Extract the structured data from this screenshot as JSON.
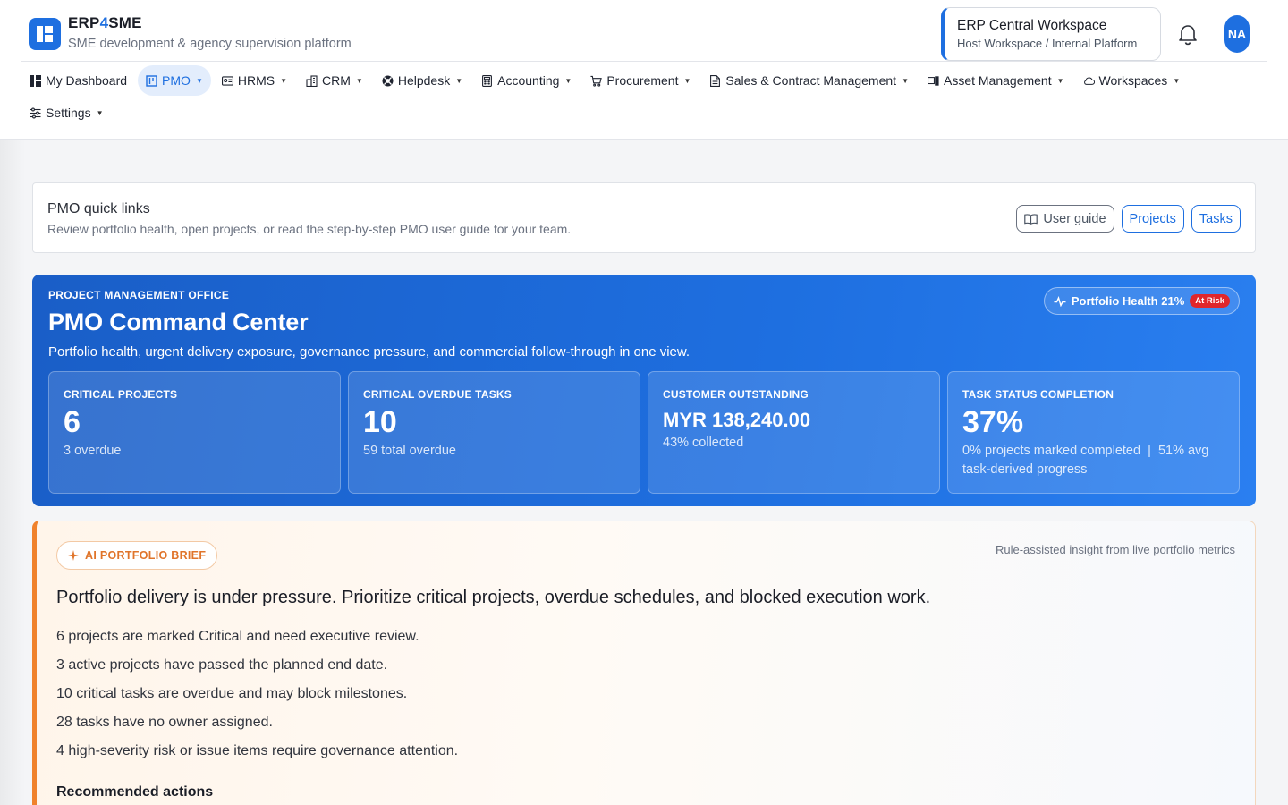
{
  "brand": {
    "name_prefix": "ERP",
    "name_accent": "4",
    "name_suffix": "SME",
    "subtitle": "SME development & agency supervision platform"
  },
  "workspace": {
    "title": "ERP Central Workspace",
    "subtitle": "Host Workspace / Internal Platform"
  },
  "user": {
    "initials": "NA"
  },
  "nav": {
    "items": [
      {
        "label": "My Dashboard",
        "icon": "dashboard-icon",
        "has_caret": false,
        "active": false
      },
      {
        "label": "PMO",
        "icon": "pmo-icon",
        "has_caret": true,
        "active": true
      },
      {
        "label": "HRMS",
        "icon": "id-card-icon",
        "has_caret": true,
        "active": false
      },
      {
        "label": "CRM",
        "icon": "building-icon",
        "has_caret": true,
        "active": false
      },
      {
        "label": "Helpdesk",
        "icon": "lifebuoy-icon",
        "has_caret": true,
        "active": false
      },
      {
        "label": "Accounting",
        "icon": "calculator-icon",
        "has_caret": true,
        "active": false
      },
      {
        "label": "Procurement",
        "icon": "cart-icon",
        "has_caret": true,
        "active": false
      },
      {
        "label": "Sales & Contract Management",
        "icon": "document-icon",
        "has_caret": true,
        "active": false
      },
      {
        "label": "Asset Management",
        "icon": "devices-icon",
        "has_caret": true,
        "active": false
      },
      {
        "label": "Workspaces",
        "icon": "cloud-icon",
        "has_caret": true,
        "active": false
      },
      {
        "label": "Settings",
        "icon": "sliders-icon",
        "has_caret": true,
        "active": false
      }
    ]
  },
  "quick_links": {
    "title": "PMO quick links",
    "description": "Review portfolio health, open projects, or read the step-by-step PMO user guide for your team.",
    "user_guide_label": "User guide",
    "projects_label": "Projects",
    "tasks_label": "Tasks"
  },
  "command_center": {
    "kicker": "PROJECT MANAGEMENT OFFICE",
    "title": "PMO Command Center",
    "description": "Portfolio health, urgent delivery exposure, governance pressure, and commercial follow-through in one view.",
    "health_label": "Portfolio Health 21%",
    "health_badge": "At Risk",
    "kpis": [
      {
        "label": "CRITICAL PROJECTS",
        "value": "6",
        "sub": "3 overdue",
        "money": false
      },
      {
        "label": "CRITICAL OVERDUE TASKS",
        "value": "10",
        "sub": "59 total overdue",
        "money": false
      },
      {
        "label": "CUSTOMER OUTSTANDING",
        "value": "MYR 138,240.00",
        "sub": "43% collected",
        "money": true
      },
      {
        "label": "TASK STATUS COMPLETION",
        "value": "37%",
        "sub": "0% projects marked completed  |  51% avg task-derived progress",
        "money": false
      }
    ]
  },
  "ai_brief": {
    "tag": "AI PORTFOLIO BRIEF",
    "note": "Rule-assisted insight from live portfolio metrics",
    "headline": "Portfolio delivery is under pressure. Prioritize critical projects, overdue schedules, and blocked execution work.",
    "points": [
      "6 projects are marked Critical and need executive review.",
      "3 active projects have passed the planned end date.",
      "10 critical tasks are overdue and may block milestones.",
      "28 tasks have no owner assigned.",
      "4 high-severity risk or issue items require governance attention."
    ],
    "recommended_heading": "Recommended actions"
  },
  "colors": {
    "accent": "#1e6fe0",
    "brief_accent": "#f0822c",
    "risk": "#e0262b"
  }
}
